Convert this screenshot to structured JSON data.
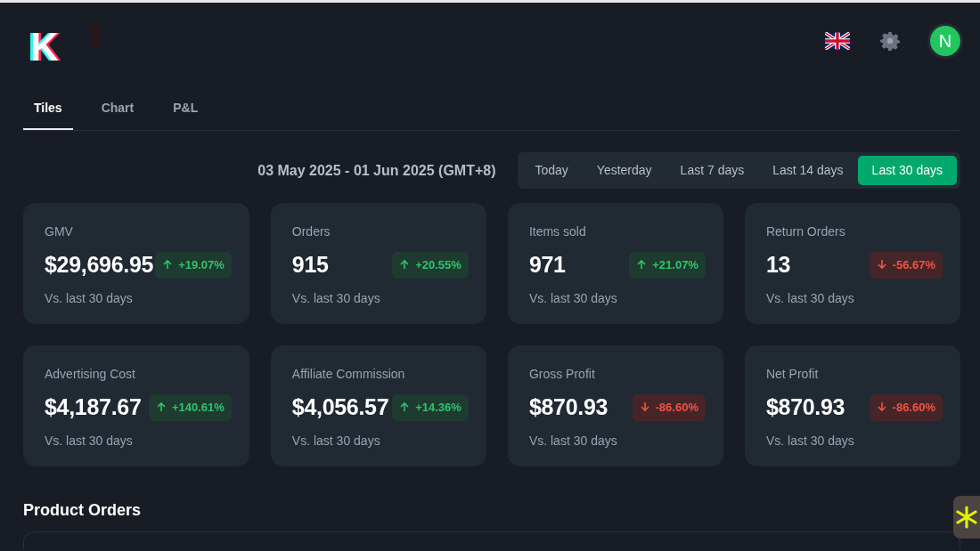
{
  "logo": {
    "letter": "K"
  },
  "tabs": [
    {
      "label": "Tiles",
      "selected": true
    },
    {
      "label": "Chart",
      "selected": false
    },
    {
      "label": "P&L",
      "selected": false
    }
  ],
  "date_range": "03 May 2025 - 01 Jun 2025 (GMT+8)",
  "periods": [
    {
      "label": "Today",
      "selected": false
    },
    {
      "label": "Yesterday",
      "selected": false
    },
    {
      "label": "Last 7 days",
      "selected": false
    },
    {
      "label": "Last 14 days",
      "selected": false
    },
    {
      "label": "Last 30 days",
      "selected": true
    }
  ],
  "avatar": {
    "initial": "N"
  },
  "tiles": [
    {
      "title": "GMV",
      "value": "$29,696.95",
      "change": "+19.07%",
      "kind": "up",
      "note": "Vs. last 30 days"
    },
    {
      "title": "Orders",
      "value": "915",
      "change": "+20.55%",
      "kind": "up",
      "note": "Vs. last 30 days"
    },
    {
      "title": "Items sold",
      "value": "971",
      "change": "+21.07%",
      "kind": "up",
      "note": "Vs. last 30 days"
    },
    {
      "title": "Return Orders",
      "value": "13",
      "change": "-56.67%",
      "kind": "down",
      "note": "Vs. last 30 days"
    },
    {
      "title": "Advertising Cost",
      "value": "$4,187.67",
      "change": "+140.61%",
      "kind": "up",
      "note": "Vs. last 30 days"
    },
    {
      "title": "Affiliate Commission",
      "value": "$4,056.57",
      "change": "+14.36%",
      "kind": "up",
      "note": "Vs. last 30 days"
    },
    {
      "title": "Gross Profit",
      "value": "$870.93",
      "change": "-86.60%",
      "kind": "down",
      "note": "Vs. last 30 days"
    },
    {
      "title": "Net Profit",
      "value": "$870.93",
      "change": "-86.60%",
      "kind": "down",
      "note": "Vs. last 30 days"
    }
  ],
  "section_title": "Product Orders"
}
